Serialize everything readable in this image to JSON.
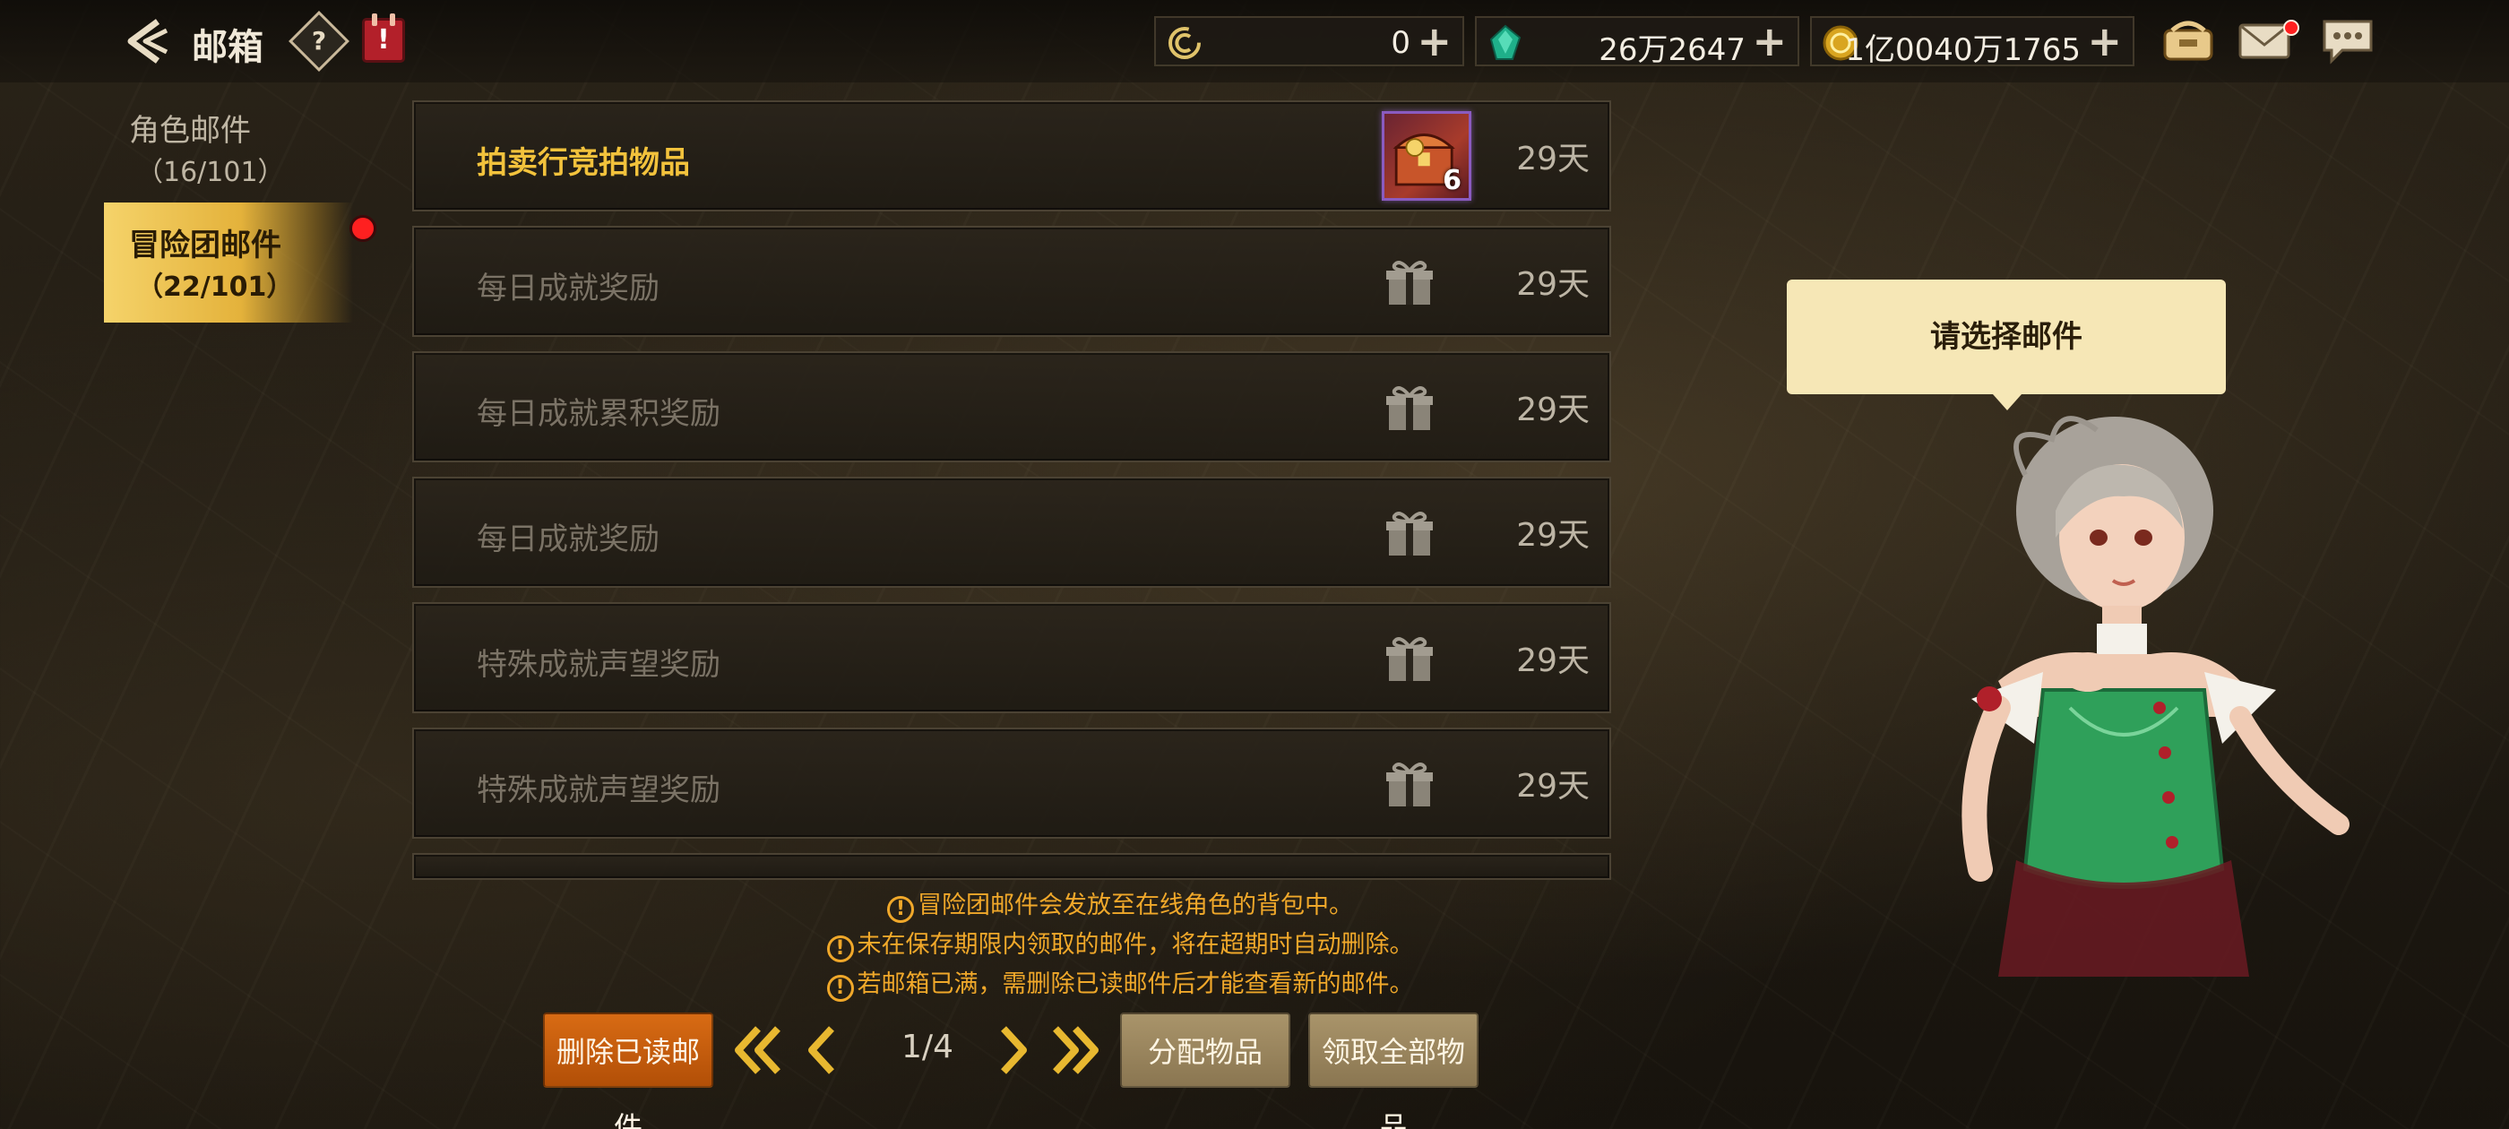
{
  "header": {
    "title": "邮箱",
    "help_icon": "question-diamond-icon",
    "calendar_icon": "calendar-alert-icon",
    "calendar_mark": "!"
  },
  "currencies": [
    {
      "icon": "c-coin-icon",
      "value": "0"
    },
    {
      "icon": "green-gem-icon",
      "value": "26万2647"
    },
    {
      "icon": "gold-coin-icon",
      "value": "1亿0040万1765"
    }
  ],
  "currency_plus": "+",
  "sidebar": {
    "tabs": [
      {
        "label": "角色邮件",
        "count": "（16/101）",
        "selected": false
      },
      {
        "label": "冒险团邮件",
        "count": "（22/101）",
        "selected": true,
        "badge": true
      }
    ]
  },
  "mails": [
    {
      "subject": "拍卖行竞拍物品",
      "days": "29天",
      "unread": true,
      "attachment": "item",
      "qty": "6"
    },
    {
      "subject": "每日成就奖励",
      "days": "29天",
      "unread": false,
      "attachment": "gift-icon"
    },
    {
      "subject": "每日成就累积奖励",
      "days": "29天",
      "unread": false,
      "attachment": "gift-icon"
    },
    {
      "subject": "每日成就奖励",
      "days": "29天",
      "unread": false,
      "attachment": "gift-icon"
    },
    {
      "subject": "特殊成就声望奖励",
      "days": "29天",
      "unread": false,
      "attachment": "gift-icon"
    },
    {
      "subject": "特殊成就声望奖励",
      "days": "29天",
      "unread": false,
      "attachment": "gift-icon"
    }
  ],
  "notices": [
    "冒险团邮件会发放至在线角色的背包中。",
    "未在保存期限内领取的邮件，将在超期时自动删除。",
    "若邮箱已满，需删除已读邮件后才能查看新的邮件。"
  ],
  "notice_mark": "!",
  "footer": {
    "delete_read": "删除已读邮件",
    "page": "1/4",
    "allot_items": "分配物品",
    "claim_all": "领取全部物品"
  },
  "speech": "请选择邮件",
  "colors": {
    "accent_gold": "#f2c23c",
    "warning_orange": "#f0a82a",
    "delete_button": "#d86b14",
    "badge_red": "#ff2020"
  }
}
